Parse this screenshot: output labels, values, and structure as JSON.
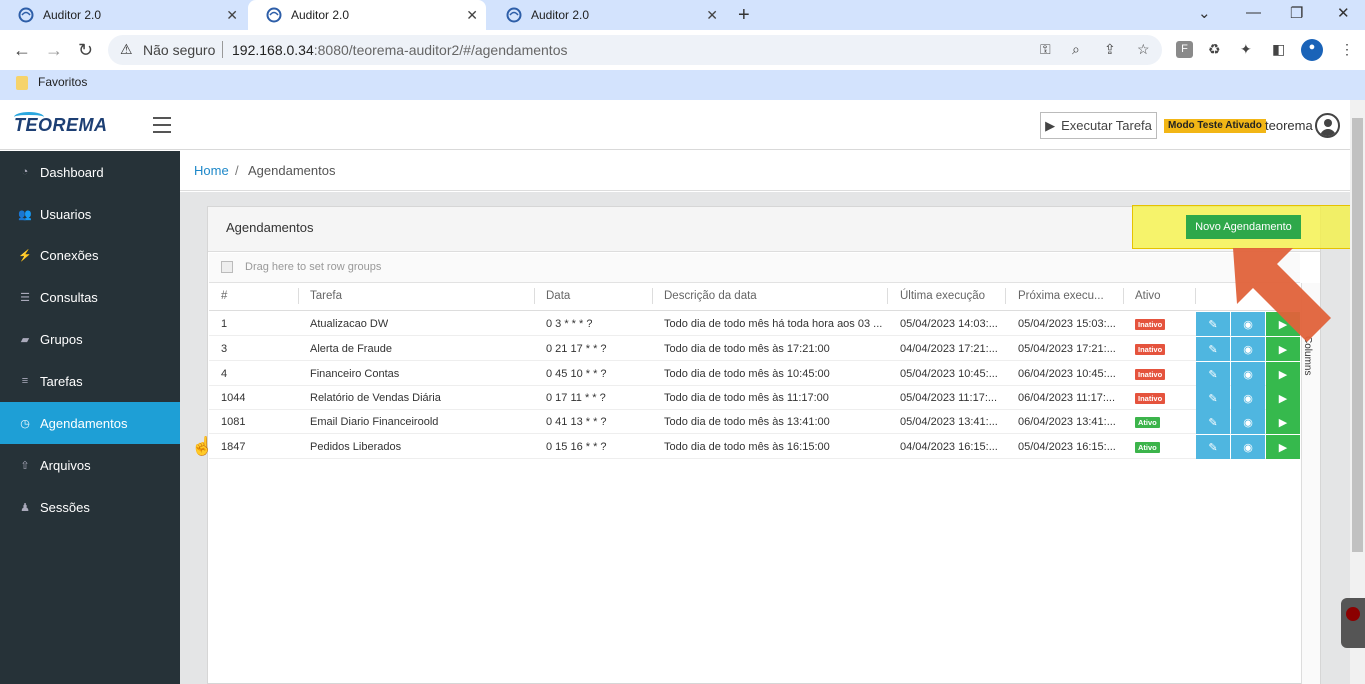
{
  "browser": {
    "tabs": [
      {
        "title": "Auditor 2.0",
        "active": false
      },
      {
        "title": "Auditor 2.0",
        "active": true
      },
      {
        "title": "Auditor 2.0",
        "active": false
      }
    ],
    "security_label": "Não seguro",
    "url_host": "192.168.0.34",
    "url_rest": ":8080/teorema-auditor2/#/agendamentos",
    "bookmark": "Favoritos"
  },
  "header": {
    "logo": "TEOREMA",
    "exec_button": "Executar Tarefa",
    "test_badge": "Modo Teste Ativado",
    "user": "teorema"
  },
  "sidebar": {
    "items": [
      {
        "label": "Dashboard",
        "icon": "dashboard-icon"
      },
      {
        "label": "Usuarios",
        "icon": "users-icon"
      },
      {
        "label": "Conexões",
        "icon": "plug-icon"
      },
      {
        "label": "Consultas",
        "icon": "database-icon"
      },
      {
        "label": "Grupos",
        "icon": "folder-icon"
      },
      {
        "label": "Tarefas",
        "icon": "list-icon"
      },
      {
        "label": "Agendamentos",
        "icon": "clock-icon",
        "active": true
      },
      {
        "label": "Arquivos",
        "icon": "upload-icon"
      },
      {
        "label": "Sessões",
        "icon": "user-icon"
      }
    ]
  },
  "breadcrumb": {
    "home": "Home",
    "sep": "/",
    "current": "Agendamentos"
  },
  "card": {
    "title": "Agendamentos",
    "new_button": "Novo Agendamento",
    "group_hint": "Drag here to set row groups",
    "columns_label": "Columns"
  },
  "grid": {
    "headers": [
      "#",
      "Tarefa",
      "Data",
      "Descrição da data",
      "Última execução",
      "Próxima execu...",
      "Ativo"
    ],
    "rows": [
      {
        "id": "1",
        "tarefa": "Atualizacao DW",
        "data": "0 3 * * * ?",
        "desc": "Todo dia de todo mês há toda hora aos 03 ...",
        "ultima": "05/04/2023 14:03:...",
        "proxima": "05/04/2023 15:03:...",
        "ativo": "Inativo"
      },
      {
        "id": "3",
        "tarefa": "Alerta de Fraude",
        "data": "0 21 17 * * ?",
        "desc": "Todo dia de todo mês às 17:21:00",
        "ultima": "04/04/2023 17:21:...",
        "proxima": "05/04/2023 17:21:...",
        "ativo": "Inativo"
      },
      {
        "id": "4",
        "tarefa": "Financeiro Contas",
        "data": "0 45 10 * * ?",
        "desc": "Todo dia de todo mês às 10:45:00",
        "ultima": "05/04/2023 10:45:...",
        "proxima": "06/04/2023 10:45:...",
        "ativo": "Inativo"
      },
      {
        "id": "1044",
        "tarefa": "Relatório de Vendas Diária",
        "data": "0 17 11 * * ?",
        "desc": "Todo dia de todo mês às 11:17:00",
        "ultima": "05/04/2023 11:17:...",
        "proxima": "06/04/2023 11:17:...",
        "ativo": "Inativo"
      },
      {
        "id": "1081",
        "tarefa": "Email Diario Financeiroold",
        "data": "0 41 13 * * ?",
        "desc": "Todo dia de todo mês às 13:41:00",
        "ultima": "05/04/2023 13:41:...",
        "proxima": "06/04/2023 13:41:...",
        "ativo": "Ativo"
      },
      {
        "id": "1847",
        "tarefa": "Pedidos Liberados",
        "data": "0 15 16 * * ?",
        "desc": "Todo dia de todo mês às 16:15:00",
        "ultima": "04/04/2023 16:15:...",
        "proxima": "05/04/2023 16:15:...",
        "ativo": "Ativo"
      }
    ]
  },
  "colors": {
    "sidebar_bg": "#263238",
    "active_item": "#1e9fd6",
    "success": "#2ea84a",
    "danger": "#e5533d",
    "info": "#4fb6e0"
  }
}
